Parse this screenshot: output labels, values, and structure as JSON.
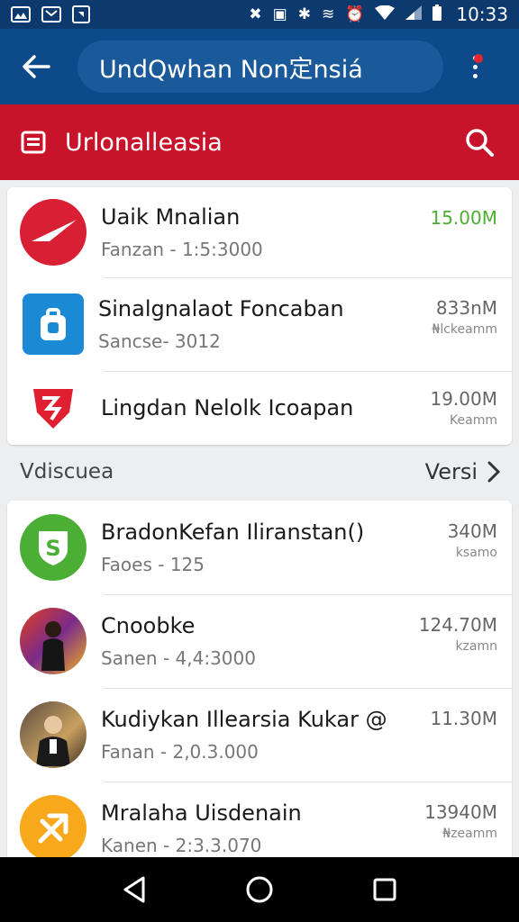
{
  "status_bar": {
    "time": "10:33",
    "left_icons": [
      "photo-icon",
      "gmail-icon",
      "notification-icon"
    ],
    "right_icons": [
      "mute-icon",
      "nfc-icon",
      "bluetooth-icon",
      "vibrate-icon",
      "alarm-icon",
      "wifi-icon",
      "signal-icon",
      "battery-icon"
    ]
  },
  "app_bar": {
    "title": "UndQwhan Non定nsiá"
  },
  "section": {
    "title": "Urlonalleasia"
  },
  "list_top": [
    {
      "name": "Uaik Mnalian",
      "sub": "Fanzan - 1:5:3000",
      "size": "15.00M",
      "unit": "",
      "size_color": "green",
      "icon": "compass-icon",
      "icon_bg": "#d91f33"
    },
    {
      "name": "Sinalgnalaot Foncaban",
      "sub": "Sancse- 3012",
      "size": "833nM",
      "unit": "₦lckeamm",
      "size_color": "gray",
      "icon": "bag-icon",
      "icon_bg": "#1a8ad4"
    },
    {
      "name": "Lingdan Nelolk Icoapan",
      "sub": "",
      "size": "19.00M",
      "unit": "Keamm",
      "size_color": "gray",
      "icon": "shield-icon",
      "icon_bg": "#ffffff"
    }
  ],
  "list_label": {
    "text": "Vdiscuea",
    "more": "Versi"
  },
  "list_bottom": [
    {
      "name": "BradonKefan Iliranstan()",
      "sub": "Faoes - 125",
      "size": "340M",
      "unit": "ksamo",
      "icon": "shield-s-icon",
      "icon_bg": "#4caf35"
    },
    {
      "name": "Cnoobke",
      "sub": "Sanen - 4,4:3000",
      "size": "124.70M",
      "unit": "kzamn",
      "icon": "person-avatar-icon",
      "icon_bg": "#7a3a2a"
    },
    {
      "name": "Kudiykan Illearsia Kukar @",
      "sub": "Fanan - 2,0.3.000",
      "size": "11.30M",
      "unit": "",
      "icon": "person-avatar-icon",
      "icon_bg": "#4a3a30"
    },
    {
      "name": "Mralaha Uisdenain",
      "sub": "Kanen - 2:3.3.070",
      "size": "13940M",
      "unit": "₦zeamm",
      "icon": "arrow-x-icon",
      "icon_bg": "#f7a81b"
    }
  ],
  "nav": {
    "buttons": [
      "back-triangle-icon",
      "home-circle-icon",
      "recents-square-icon"
    ]
  },
  "colors": {
    "status_bar": "#0d3a6e",
    "app_bar": "#0c4a8a",
    "section_bar": "#c8142a",
    "accent_green": "#4caf2f"
  }
}
